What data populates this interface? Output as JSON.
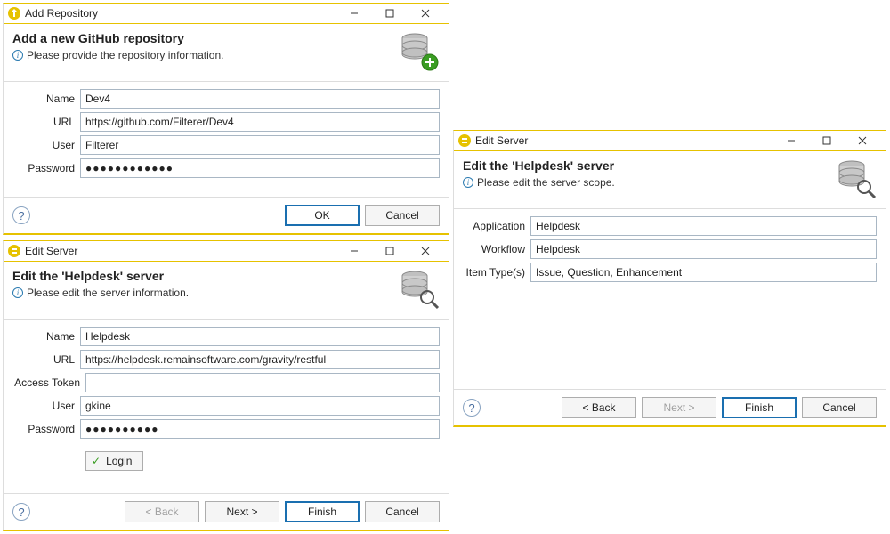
{
  "dialog1": {
    "title": "Add Repository",
    "heading": "Add a new GitHub repository",
    "subtitle": "Please provide the repository information.",
    "fields": {
      "name_label": "Name",
      "name_value": "Dev4",
      "url_label": "URL",
      "url_value": "https://github.com/Filterer/Dev4",
      "user_label": "User",
      "user_value": "Filterer",
      "password_label": "Password",
      "password_value": "●●●●●●●●●●●●"
    },
    "buttons": {
      "ok": "OK",
      "cancel": "Cancel"
    }
  },
  "dialog2": {
    "title": "Edit Server",
    "heading": "Edit the 'Helpdesk' server",
    "subtitle": "Please edit the server information.",
    "fields": {
      "name_label": "Name",
      "name_value": "Helpdesk",
      "url_label": "URL",
      "url_value": "https://helpdesk.remainsoftware.com/gravity/restful",
      "token_label": "Access Token",
      "token_value": "",
      "user_label": "User",
      "user_value": "gkine",
      "password_label": "Password",
      "password_value": "●●●●●●●●●●"
    },
    "login_label": "Login",
    "buttons": {
      "back": "< Back",
      "next": "Next >",
      "finish": "Finish",
      "cancel": "Cancel"
    }
  },
  "dialog3": {
    "title": "Edit Server",
    "heading": "Edit the 'Helpdesk' server",
    "subtitle": "Please edit the server scope.",
    "fields": {
      "app_label": "Application",
      "app_value": "Helpdesk",
      "workflow_label": "Workflow",
      "workflow_value": "Helpdesk",
      "items_label": "Item Type(s)",
      "items_value": "Issue, Question, Enhancement"
    },
    "buttons": {
      "back": "< Back",
      "next": "Next >",
      "finish": "Finish",
      "cancel": "Cancel"
    }
  }
}
